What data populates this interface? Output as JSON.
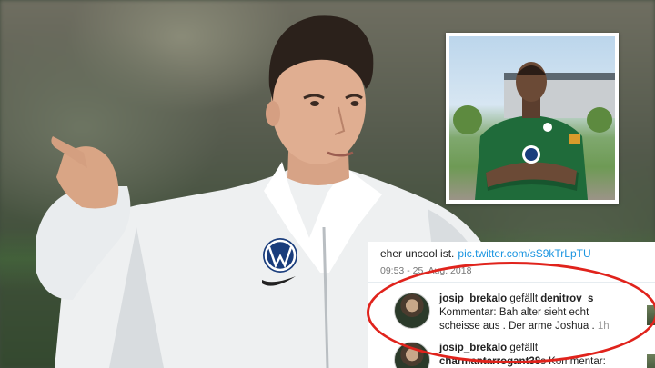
{
  "tweet": {
    "text": "eher uncool ist.",
    "link": "pic.twitter.com/sS9kTrLpTU",
    "time": "09:53 - 25. Aug. 2018"
  },
  "notifications": [
    {
      "user": "josip_brekalo",
      "action": "gefällt",
      "target": "denitrov_s",
      "line2": "Kommentar: Bah alter sieht echt",
      "line3": "scheisse aus . Der arme Joshua .",
      "age": "1h"
    },
    {
      "user": "josip_brekalo",
      "action": "gefällt",
      "target": "charmantarrogant38",
      "line2_suffix": "s Kommentar:"
    }
  ],
  "colors": {
    "link": "#1b95e0",
    "highlight": "#e0231c",
    "wolfsburg_green": "#1f6b3a"
  },
  "icons": [
    "vw-logo-icon",
    "nike-swoosh-icon",
    "wolfsburg-crest-icon"
  ]
}
